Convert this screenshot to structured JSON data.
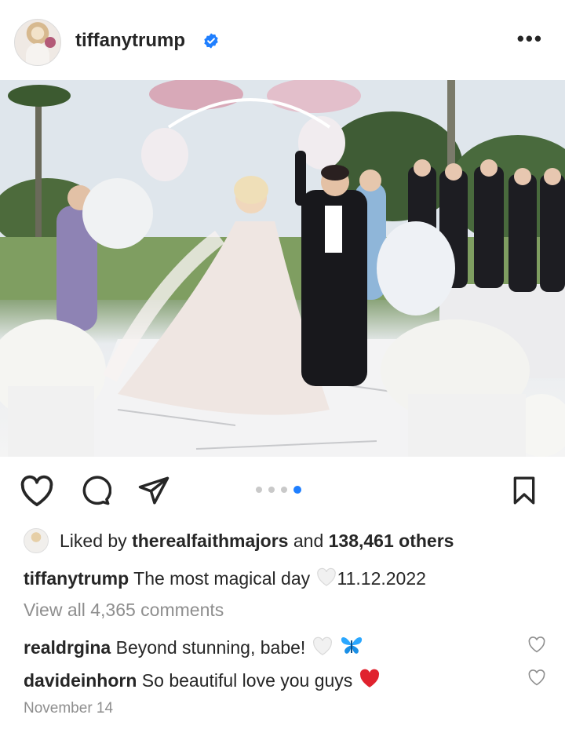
{
  "header": {
    "username": "tiffanytrump",
    "verified_icon": "verified-badge-icon",
    "more_icon": "more-options-icon",
    "more_text": "•••"
  },
  "photo": {
    "alt": "Wedding photo"
  },
  "actions": {
    "icons": [
      "heart-icon",
      "comment-icon",
      "share-icon",
      "bookmark-icon"
    ],
    "carousel": {
      "count": 4,
      "active_index": 3
    }
  },
  "likes": {
    "prefix": "Liked by",
    "user": "therealfaithmajors",
    "middle": "and",
    "count": "138,461 others"
  },
  "caption": {
    "user": "tiffanytrump",
    "text": "The most magical day",
    "date": "11.12.2022"
  },
  "comments_link": "View all 4,365 comments",
  "comments": [
    {
      "user": "realdrgina",
      "text": "Beyond stunning, babe!"
    },
    {
      "user": "davideinhorn",
      "text": "So beautiful love you guys"
    }
  ],
  "timestamp": "November 14",
  "colors": {
    "text": "#262626",
    "muted": "#8e8e8e",
    "verified": "#1f7fff",
    "heart_red": "#e0222e",
    "butterfly": "#2aa7ff"
  }
}
